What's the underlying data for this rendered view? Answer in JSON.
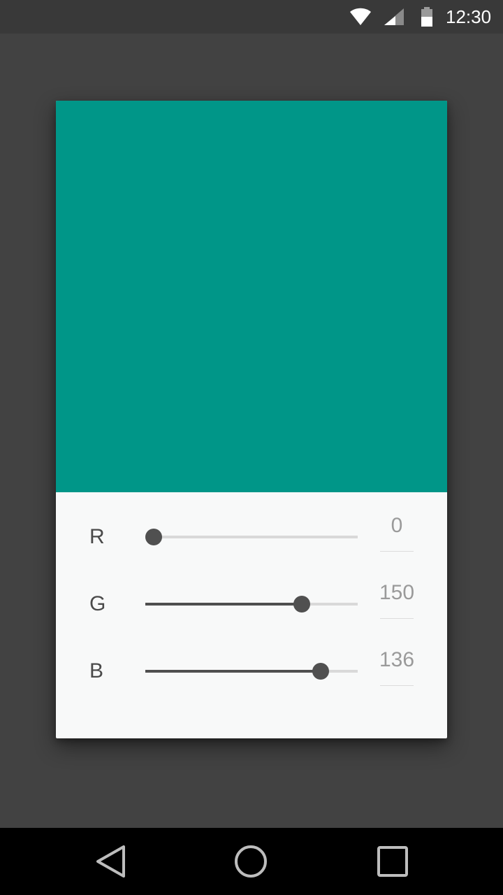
{
  "status_bar": {
    "time": "12:30",
    "icons": [
      "wifi-icon",
      "cell-signal-icon",
      "battery-icon"
    ]
  },
  "color_picker": {
    "preview_color": "#009688",
    "channels": [
      {
        "label": "R",
        "value": "0",
        "fraction": 0.0
      },
      {
        "label": "G",
        "value": "150",
        "fraction": 0.7368
      },
      {
        "label": "B",
        "value": "136",
        "fraction": 0.8289
      }
    ]
  },
  "nav_bar": {
    "buttons": [
      "back-icon",
      "home-icon",
      "recents-icon"
    ]
  },
  "colors": {
    "background": "#424242",
    "dialog": "#f8f9f9",
    "slider_active": "#4f4f4f",
    "slider_track": "#d9d9d9"
  }
}
